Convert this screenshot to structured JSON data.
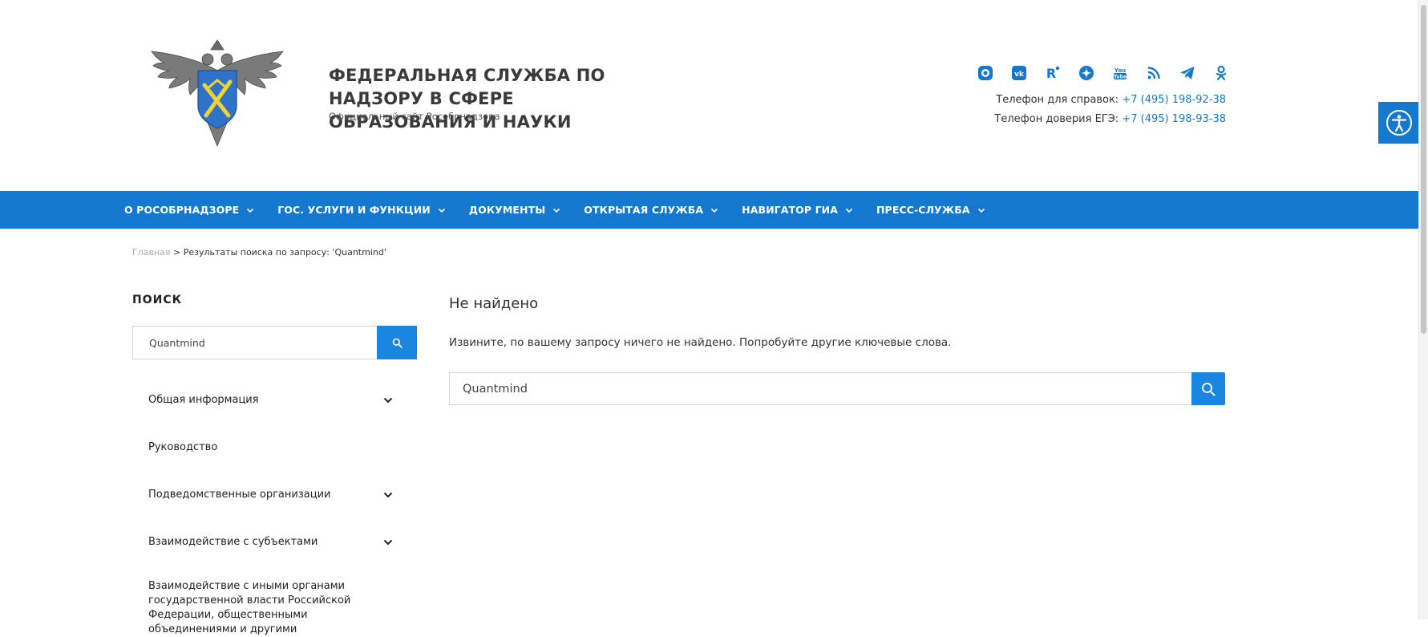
{
  "header": {
    "title": "ФЕДЕРАЛЬНАЯ СЛУЖБА ПО НАДЗОРУ В СФЕРЕ ОБРАЗОВАНИЯ И НАУКИ",
    "subtitle": "Официальный сайт Рособрнадзора",
    "socials": [
      "max-icon",
      "vk-icon",
      "rutube-icon",
      "dzen-icon",
      "youtube-icon",
      "rss-icon",
      "telegram-icon",
      "odnoklassniki-icon"
    ],
    "phone_label": "Телефон для справок:",
    "phone_value": "+7 (495) 198-92-38",
    "hotline_label": "Телефон доверия ЕГЭ:",
    "hotline_value": "+7 (495) 198-93-38",
    "accessibility_icon": "accessibility-icon"
  },
  "nav": {
    "items": [
      {
        "label": "О РОСОБРНАДЗОРЕ"
      },
      {
        "label": "ГОС. УСЛУГИ И ФУНКЦИИ"
      },
      {
        "label": "ДОКУМЕНТЫ"
      },
      {
        "label": "ОТКРЫТАЯ СЛУЖБА"
      },
      {
        "label": "НАВИГАТОР ГИА"
      },
      {
        "label": "ПРЕСС-СЛУЖБА"
      }
    ]
  },
  "breadcrumb": {
    "home": "Главная",
    "separator": ">",
    "current": "Результаты поиска по запросу: 'Quantmind'"
  },
  "sidebar": {
    "title": "ПОИСК",
    "search_value": "Quantmind",
    "menu": [
      {
        "label": "Общая информация"
      },
      {
        "label": "Руководство"
      },
      {
        "label": "Подведомственные организации"
      },
      {
        "label": "Взаимодействие с субъектами"
      },
      {
        "label": "Взаимодействие с иными органами государственной власти Российской Федерации, общественными объединениями и другими"
      }
    ]
  },
  "main": {
    "title": "Не найдено",
    "message": "Извините, по вашему запросу ничего не найдено. Попробуйте другие ключевые слова.",
    "search_value": "Quantmind"
  },
  "colors": {
    "primary": "#1478cf",
    "button": "#1a86e0",
    "text": "#222222"
  }
}
